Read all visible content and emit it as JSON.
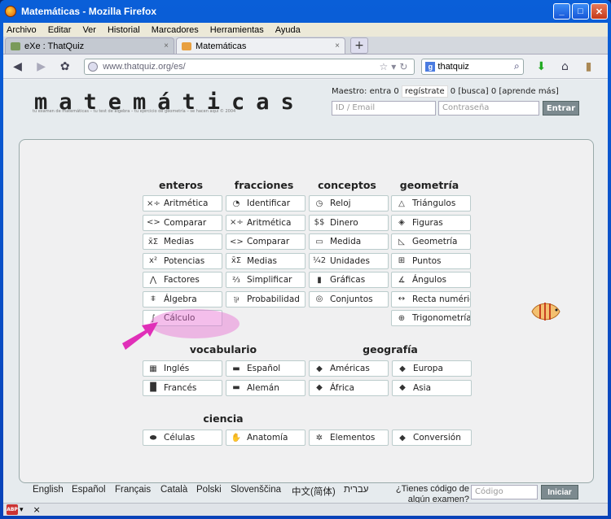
{
  "window": {
    "title": "Matemáticas - Mozilla Firefox",
    "min": "_",
    "max": "□",
    "close": "✕"
  },
  "menu": [
    "Archivo",
    "Editar",
    "Ver",
    "Historial",
    "Marcadores",
    "Herramientas",
    "Ayuda"
  ],
  "tabs": [
    {
      "label": "eXe : ThatQuiz",
      "close": "×"
    },
    {
      "label": "Matemáticas",
      "close": "×"
    }
  ],
  "newtab": "+",
  "url": "www.thatquiz.org/es/",
  "search_value": "thatquiz",
  "site": {
    "logo": "matemáticas",
    "tagline": "tu examen de matemáticas – tu test de álgebra – tu ejercicio de geometría – se hacen aquí © 2004",
    "maestro_prefix": "Maestro: entra 0",
    "registrate": "regístrate",
    "maestro_suffix": "0 [busca] 0 [aprende más]",
    "email_placeholder": "ID / Email",
    "password_placeholder": "Contraseña",
    "entrar": "Entrar"
  },
  "headers": {
    "enteros": "enteros",
    "fracciones": "fracciones",
    "conceptos": "conceptos",
    "geometria": "geometría",
    "vocabulario": "vocabulario",
    "geografia": "geografía",
    "ciencia": "ciencia"
  },
  "enteros": [
    {
      "label": "Aritmética",
      "icon": "×÷"
    },
    {
      "label": "Comparar",
      "icon": "<>"
    },
    {
      "label": "Medias",
      "icon": "x̄Σ"
    },
    {
      "label": "Potencias",
      "icon": "x²"
    },
    {
      "label": "Factores",
      "icon": "⋀"
    },
    {
      "label": "Álgebra",
      "icon": "⩨"
    },
    {
      "label": "Cálculo",
      "icon": "∫"
    }
  ],
  "fracciones": [
    {
      "label": "Identificar",
      "icon": "◔"
    },
    {
      "label": "Aritmética",
      "icon": "×÷"
    },
    {
      "label": "Comparar",
      "icon": "<>"
    },
    {
      "label": "Medias",
      "icon": "x̄Σ"
    },
    {
      "label": "Simplificar",
      "icon": "⅔"
    },
    {
      "label": "Probabilidad",
      "icon": "⅌"
    }
  ],
  "conceptos": [
    {
      "label": "Reloj",
      "icon": "◷"
    },
    {
      "label": "Dinero",
      "icon": "$$"
    },
    {
      "label": "Medida",
      "icon": "▭"
    },
    {
      "label": "Unidades",
      "icon": "¼2"
    },
    {
      "label": "Gráficas",
      "icon": "▮"
    },
    {
      "label": "Conjuntos",
      "icon": "◎"
    }
  ],
  "geometria": [
    {
      "label": "Triángulos",
      "icon": "△"
    },
    {
      "label": "Figuras",
      "icon": "◈"
    },
    {
      "label": "Geometría",
      "icon": "◺"
    },
    {
      "label": "Puntos",
      "icon": "⊞"
    },
    {
      "label": "Ángulos",
      "icon": "∡"
    },
    {
      "label": "Recta numérica",
      "icon": "↔"
    },
    {
      "label": "Trigonometría",
      "icon": "⊕"
    }
  ],
  "vocabulario": [
    {
      "label": "Inglés",
      "icon": "▦"
    },
    {
      "label": "Español",
      "icon": "▬"
    },
    {
      "label": "Francés",
      "icon": "▐▌"
    },
    {
      "label": "Alemán",
      "icon": "▬"
    }
  ],
  "geografia": [
    {
      "label": "Américas",
      "icon": "◆"
    },
    {
      "label": "Europa",
      "icon": "◆"
    },
    {
      "label": "África",
      "icon": "◆"
    },
    {
      "label": "Asia",
      "icon": "◆"
    }
  ],
  "ciencia": [
    {
      "label": "Células",
      "icon": "⬬"
    },
    {
      "label": "Anatomía",
      "icon": "✋"
    },
    {
      "label": "Elementos",
      "icon": "✲"
    },
    {
      "label": "Conversión",
      "icon": "◆"
    }
  ],
  "footer": {
    "languages": [
      "English",
      "Español",
      "Français",
      "Català",
      "Polski",
      "Slovenščina",
      "中文(简体)",
      "עברית"
    ],
    "code_prompt": "¿Tienes código de algún examen?",
    "code_placeholder": "Código",
    "iniciar": "Iniciar"
  },
  "statusbar": {
    "abp": "ABP",
    "close": "×"
  }
}
